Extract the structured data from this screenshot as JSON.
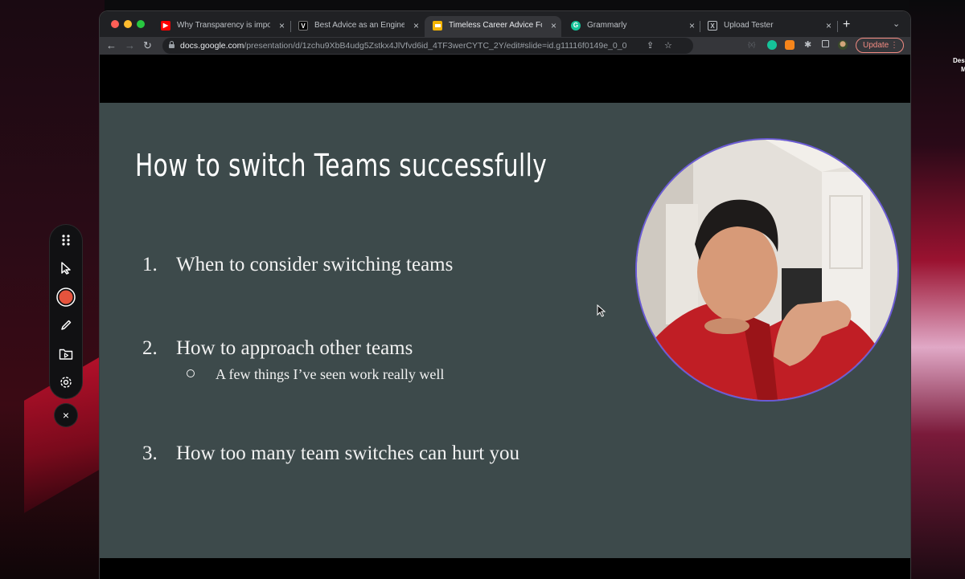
{
  "desktop": {
    "label_line1": "Des",
    "label_line2": "M"
  },
  "browser": {
    "tabs": [
      {
        "title": "Why Transparency is importan",
        "favicon": "youtube-icon",
        "favicon_color": "#ff0000",
        "active": false
      },
      {
        "title": "Best Advice as an Engineering",
        "favicon": "v-icon",
        "favicon_color": "#000000",
        "active": false
      },
      {
        "title": "Timeless Career Advice For En",
        "favicon": "slides-icon",
        "favicon_color": "#f4b400",
        "active": true
      },
      {
        "title": "Grammarly",
        "favicon": "grammarly-icon",
        "favicon_color": "#15c39a",
        "active": false
      },
      {
        "title": "Upload Tester",
        "favicon": "x-box-icon",
        "favicon_color": "#5f6368",
        "active": false
      }
    ],
    "close_glyph": "×",
    "new_tab_glyph": "+",
    "tab_menu_glyph": "⌄",
    "url_host": "docs.google.com",
    "url_path": "/presentation/d/1zchu9XbB4udg5Zstkx4JlVfvd6id_4TF3werCYTC_2Y/edit#slide=id.g11116f0149e_0_0",
    "update_label": "Update",
    "update_menu_glyph": "⋮",
    "accent_color": "#f28b82"
  },
  "slide": {
    "title": "How to switch Teams successfully",
    "items": [
      {
        "number": "1.",
        "text": "When to consider switching teams"
      },
      {
        "number": "2.",
        "text": "How to approach other teams"
      },
      {
        "number": "3.",
        "text": "How too many team switches can hurt you"
      }
    ],
    "subitem": "A few things I’ve seen work really well",
    "background_color": "#3d4a4b"
  },
  "recorder": {
    "tools": [
      "drag-handle-icon",
      "pointer-icon",
      "record-icon",
      "pen-icon",
      "folder-video-icon",
      "settings-icon"
    ],
    "record_color": "#e5533d",
    "close_glyph": "×"
  }
}
